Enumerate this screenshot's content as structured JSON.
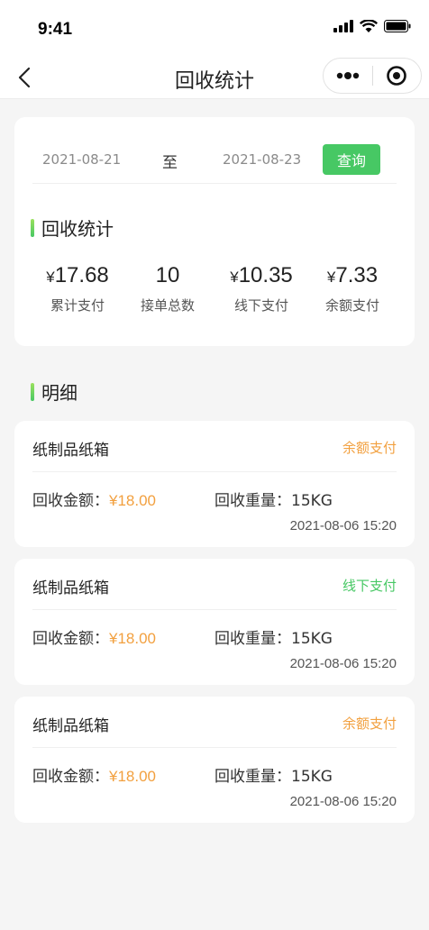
{
  "status_bar": {
    "time": "9:41"
  },
  "nav": {
    "title": "回收统计"
  },
  "filter": {
    "start_date": "2021-08-21",
    "separator": "至",
    "end_date": "2021-08-23",
    "query_label": "查询"
  },
  "stats": {
    "title": "回收统计",
    "items": [
      {
        "currency": "¥",
        "value": "17.68",
        "label": "累计支付"
      },
      {
        "currency": "",
        "value": "10",
        "label": "接单总数"
      },
      {
        "currency": "¥",
        "value": "10.35",
        "label": "线下支付"
      },
      {
        "currency": "¥",
        "value": "7.33",
        "label": "余额支付"
      }
    ]
  },
  "detail": {
    "title": "明细",
    "records": [
      {
        "name": "纸制品纸箱",
        "payment": "余额支付",
        "amount_label": "回收金额：",
        "amount": "¥18.00",
        "weight_label": "回收重量：",
        "weight": "15KG",
        "time": "2021-08-06  15:20"
      },
      {
        "name": "纸制品纸箱",
        "payment": "线下支付",
        "amount_label": "回收金额：",
        "amount": "¥18.00",
        "weight_label": "回收重量：",
        "weight": "15KG",
        "time": "2021-08-06  15:20"
      },
      {
        "name": "纸制品纸箱",
        "payment": "余额支付",
        "amount_label": "回收金额：",
        "amount": "¥18.00",
        "weight_label": "回收重量：",
        "weight": "15KG",
        "time": "2021-08-06  15:20"
      }
    ]
  },
  "colors": {
    "accent_green": "#47c864",
    "amount_orange": "#f2a03f",
    "balance_pay": "#f2a03f",
    "offline_pay": "#47c864"
  }
}
